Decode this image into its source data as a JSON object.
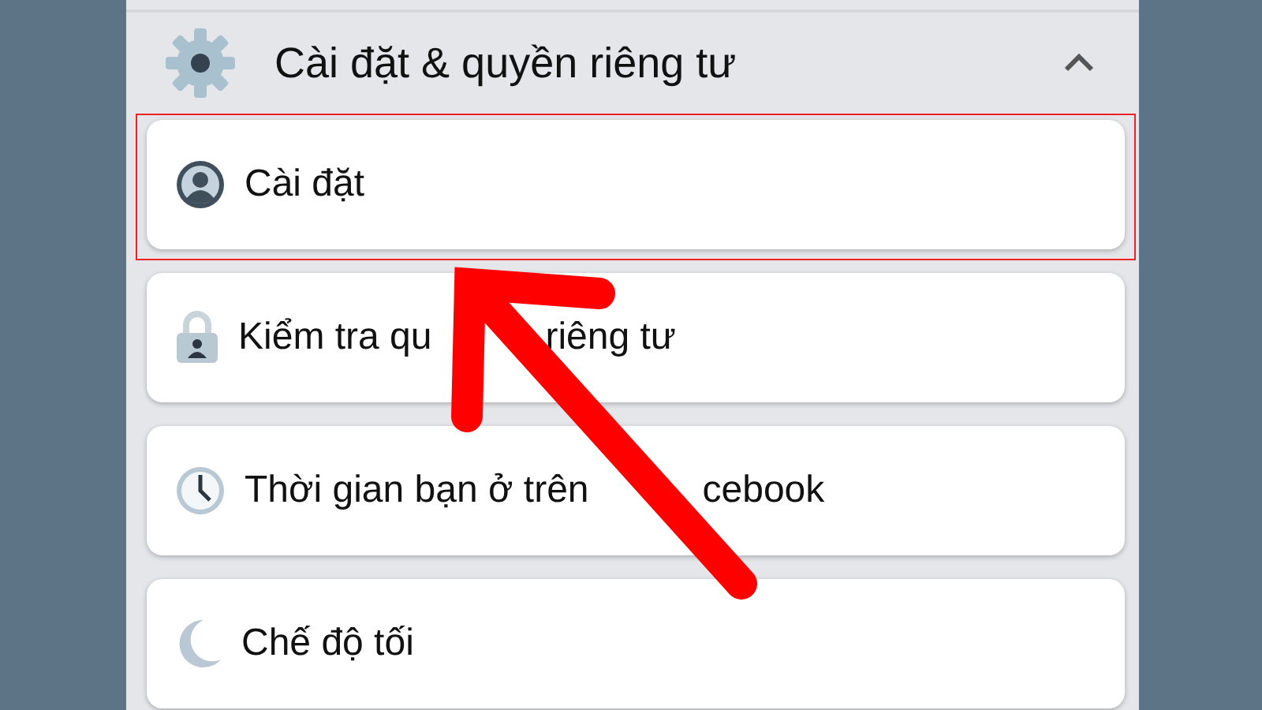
{
  "section": {
    "title": "Cài đặt & quyền riêng tư",
    "expanded": true
  },
  "items": [
    {
      "parts": [
        "Cài đặt"
      ],
      "highlighted": true
    },
    {
      "parts": [
        "Kiểm tra qu",
        "riêng tư"
      ],
      "highlighted": false
    },
    {
      "parts": [
        "Thời gian bạn ở trên",
        "cebook"
      ],
      "highlighted": false
    },
    {
      "parts": [
        "Chế độ tối"
      ],
      "highlighted": false
    }
  ]
}
